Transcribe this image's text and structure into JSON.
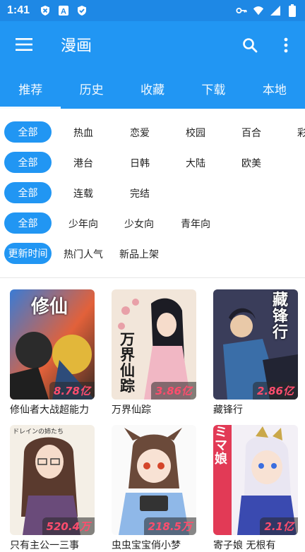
{
  "status": {
    "time": "1:41",
    "left_icons": [
      "shield-x-icon",
      "a-box-icon",
      "shield-check-icon"
    ],
    "right_icons": [
      "key-icon",
      "wifi-icon",
      "signal-icon",
      "battery-icon"
    ]
  },
  "appbar": {
    "title": "漫画",
    "menu_icon": "menu-icon",
    "search_icon": "search-icon",
    "more_icon": "more-vert-icon"
  },
  "tabs": [
    {
      "label": "推荐",
      "active": true
    },
    {
      "label": "历史",
      "active": false
    },
    {
      "label": "收藏",
      "active": false
    },
    {
      "label": "下载",
      "active": false
    },
    {
      "label": "本地",
      "active": false
    }
  ],
  "filters": {
    "row1": {
      "chip": "全部",
      "options": [
        "热血",
        "恋爱",
        "校园",
        "百合",
        "彩"
      ]
    },
    "row2": {
      "chip": "全部",
      "options": [
        "港台",
        "日韩",
        "大陆",
        "欧美"
      ]
    },
    "row3": {
      "chip": "全部",
      "options": [
        "连载",
        "完结"
      ]
    },
    "row4": {
      "chip": "全部",
      "options": [
        "少年向",
        "少女向",
        "青年向"
      ]
    },
    "row5": {
      "chip": "更新时间",
      "options": [
        "热门人气",
        "新品上架"
      ]
    }
  },
  "comics": [
    {
      "title": "修仙者大战超能力",
      "views": "8.78亿",
      "cover_text": "修仙"
    },
    {
      "title": "万界仙踪",
      "views": "3.86亿",
      "cover_text": "万界仙踪"
    },
    {
      "title": "藏锋行",
      "views": "2.86亿",
      "cover_text": "藏锋行"
    },
    {
      "title": "只有主公一三事",
      "views": "520.4万",
      "cover_text": "ドレインの姉たち"
    },
    {
      "title": "虫虫宝宝俏小梦",
      "views": "218.5万",
      "cover_text": ""
    },
    {
      "title": "寄子娘 无根有",
      "views": "2.1亿",
      "cover_text": "ミマ娘"
    }
  ],
  "colors": {
    "primary": "#2196f3",
    "status": "#1e88e5",
    "badge_text": "#ff4d6d"
  }
}
